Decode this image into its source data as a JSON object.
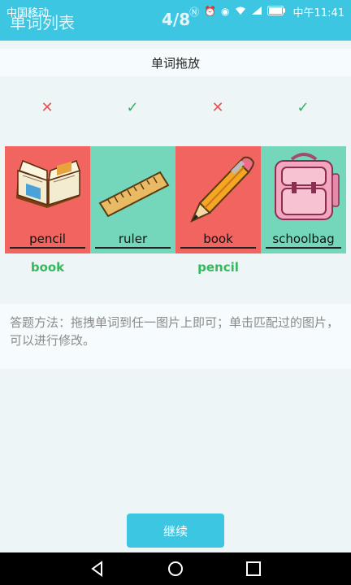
{
  "status_bar": {
    "carrier": "中国移动",
    "time": "中午11:41",
    "icons": [
      "nfc-icon",
      "alarm-icon",
      "eye-icon",
      "wifi-icon",
      "signal-icon",
      "battery-icon"
    ]
  },
  "header": {
    "title": "单词列表",
    "counter": "4/8"
  },
  "section": {
    "title": "单词拖放"
  },
  "marks": [
    {
      "state": "wrong",
      "symbol": "✕"
    },
    {
      "state": "right",
      "symbol": "✓"
    },
    {
      "state": "wrong",
      "symbol": "✕"
    },
    {
      "state": "right",
      "symbol": "✓"
    }
  ],
  "cards": [
    {
      "image": "book-icon",
      "bg": "#f1645f",
      "word": "pencil"
    },
    {
      "image": "ruler-icon",
      "bg": "#74d7bc",
      "word": "ruler"
    },
    {
      "image": "pencil-icon",
      "bg": "#f1645f",
      "word": "book"
    },
    {
      "image": "schoolbag-icon",
      "bg": "#74d7bc",
      "word": "schoolbag"
    }
  ],
  "answers": [
    "book",
    "",
    "pencil",
    ""
  ],
  "tip": "答题方法：拖拽单词到任一图片上即可；单击匹配过的图片，可以进行修改。",
  "continue_label": "继续",
  "colors": {
    "accent": "#3cc6e2",
    "wrong": "#e4544f",
    "right": "#2fb55c",
    "card_red": "#f1645f",
    "card_green": "#74d7bc"
  }
}
